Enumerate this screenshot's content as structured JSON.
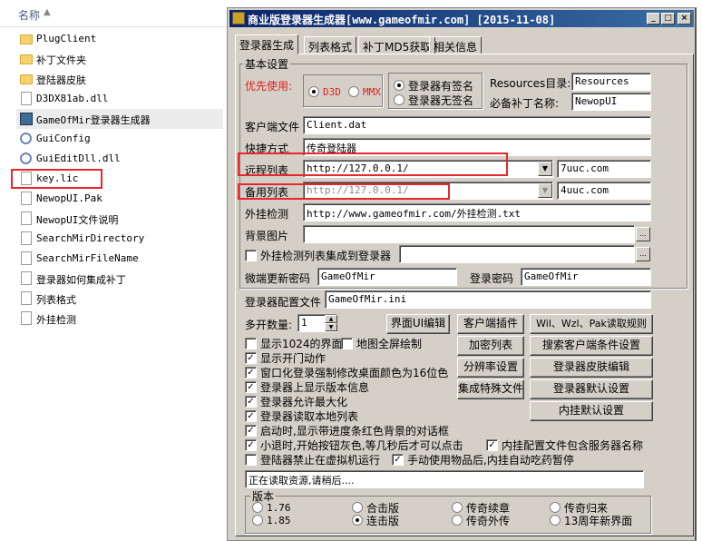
{
  "explorer": {
    "column_header": "名称",
    "sort_arrow": "▲",
    "files": [
      {
        "name": "PlugClient",
        "icon": "folder-icon"
      },
      {
        "name": "补丁文件夹",
        "icon": "folder-icon"
      },
      {
        "name": "登陆器皮肤",
        "icon": "folder-icon"
      },
      {
        "name": "D3DX81ab.dll",
        "icon": "dll-file-icon"
      },
      {
        "name": "GameOfMir登录器生成器",
        "icon": "exe-icon"
      },
      {
        "name": "GuiConfig",
        "icon": "config-icon"
      },
      {
        "name": "GuiEditDll.dll",
        "icon": "dll-file-icon"
      },
      {
        "name": "key.lic",
        "icon": "file-icon"
      },
      {
        "name": "NewopUI.Pak",
        "icon": "file-icon"
      },
      {
        "name": "NewopUI文件说明",
        "icon": "text-file-icon"
      },
      {
        "name": "SearchMirDirectory",
        "icon": "text-file-icon"
      },
      {
        "name": "SearchMirFileName",
        "icon": "text-file-icon"
      },
      {
        "name": "登录器如何集成补丁",
        "icon": "text-file-icon"
      },
      {
        "name": "列表格式",
        "icon": "text-file-icon"
      },
      {
        "name": "外挂检测",
        "icon": "text-file-icon"
      }
    ]
  },
  "window": {
    "title": "商业版登录器生成器[www.gameofmir.com] [2015-11-08]",
    "min_label": "_",
    "max_label": "□",
    "close_label": "×",
    "tabs": [
      "登录器生成",
      "列表格式",
      "补丁MD5获取",
      "相关信息"
    ]
  },
  "basic": {
    "group_label": "基本设置",
    "priority_label": "优先使用:",
    "d3d": "D3D",
    "mmx": "MMX",
    "sign_on": "登录器有签名",
    "sign_off": "登录器无签名",
    "resources_label": "Resources目录:",
    "resources_value": "Resources",
    "patch_name_label": "必备补丁名称:",
    "patch_name_value": "NewopUI",
    "client_file_label": "客户端文件",
    "client_file_value": "Client.dat",
    "shortcut_label": "快捷方式",
    "shortcut_value": "传奇登陆器",
    "remote_list_label": "远程列表",
    "remote_list_value": "http://127.0.0.1/",
    "remote_extra": "7uuc.com",
    "backup_list_label": "备用列表",
    "backup_list_value": "http://127.0.0.1/",
    "backup_extra": "4uuc.com",
    "cheat_detect_label": "外挂检测",
    "cheat_detect_value": "http://www.gameofmir.com/外挂检测.txt",
    "bg_image_label": "背景图片",
    "bg_image_value": "",
    "integrate_label": "外挂检测列表集成到登录器",
    "integrate_value": "",
    "browse_label": "...",
    "micro_pwd_label": "微端更新密码",
    "micro_pwd_value": "GameOfMir",
    "login_pwd_label": "登录密码",
    "login_pwd_value": "GameOfMir",
    "config_file_label": "登录器配置文件",
    "config_file_value": "GameOfMir.ini",
    "multi_open_label": "多开数量:",
    "multi_open_value": "1"
  },
  "buttons": {
    "ui_edit": "界面UI编辑",
    "client_plugin": "客户端插件",
    "encrypt_list": "加密列表",
    "resolution": "分辨率设置",
    "integrate_special": "集成特殊文件",
    "wil_read": "Wil、Wzl、Pak读取规则",
    "search_client": "搜索客户端条件设置",
    "skin_edit": "登录器皮肤编辑",
    "default_settings": "登录器默认设置",
    "builtin_defaults": "内挂默认设置"
  },
  "options": [
    {
      "label": "显示1024的界面",
      "checked": false
    },
    {
      "label": "地图全屏绘制",
      "checked": false
    },
    {
      "label": "显示开门动作",
      "checked": true
    },
    {
      "label": "窗口化登录强制修改桌面颜色为16位色",
      "checked": true
    },
    {
      "label": "登录器上显示版本信息",
      "checked": true
    },
    {
      "label": "登录器允许最大化",
      "checked": true
    },
    {
      "label": "登录器读取本地列表",
      "checked": true
    },
    {
      "label": "启动时,显示带进度条红色背景的对话框",
      "checked": true
    },
    {
      "label": "小退时,开始按钮灰色,等几秒后才可以点击",
      "checked": true
    },
    {
      "label": "内挂配置文件包含服务器名称",
      "checked": true
    },
    {
      "label": "登陆器禁止在虚拟机运行",
      "checked": false
    },
    {
      "label": "手动使用物品后,内挂自动吃药暂停",
      "checked": true
    }
  ],
  "status": "正在读取资源,请稍后....",
  "version": {
    "group_label": "版本",
    "options": [
      "1.76",
      "1.85",
      "合击版",
      "连击版",
      "传奇续章",
      "传奇外传",
      "传奇归来",
      "13周年新界面"
    ],
    "selected": "连击版"
  }
}
